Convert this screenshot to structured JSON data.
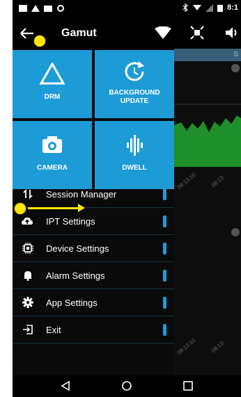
{
  "status_bar": {
    "time": "8:1"
  },
  "toolbar": {
    "title": "Gamut"
  },
  "tiles": [
    {
      "label": "DRM"
    },
    {
      "label": "BACKGROUND UPDATE"
    },
    {
      "label": "CAMERA"
    },
    {
      "label": "DWELL"
    }
  ],
  "menu": [
    {
      "label": "Session Manager",
      "icon": "session-icon"
    },
    {
      "label": "IPT Settings",
      "icon": "cloud-upload-icon"
    },
    {
      "label": "Device Settings",
      "icon": "chip-icon"
    },
    {
      "label": "Alarm Settings",
      "icon": "bell-icon"
    },
    {
      "label": "App Settings",
      "icon": "gear-icon"
    },
    {
      "label": "Exit",
      "icon": "exit-icon"
    }
  ],
  "background": {
    "tab_text": "S",
    "ticks": [
      "08:13:10",
      "08:13:",
      "08:13:10",
      "08:13:"
    ]
  },
  "colors": {
    "accent": "#1d9bd6",
    "highlight": "#ffe600",
    "chart_fill": "#1f8f2a"
  }
}
